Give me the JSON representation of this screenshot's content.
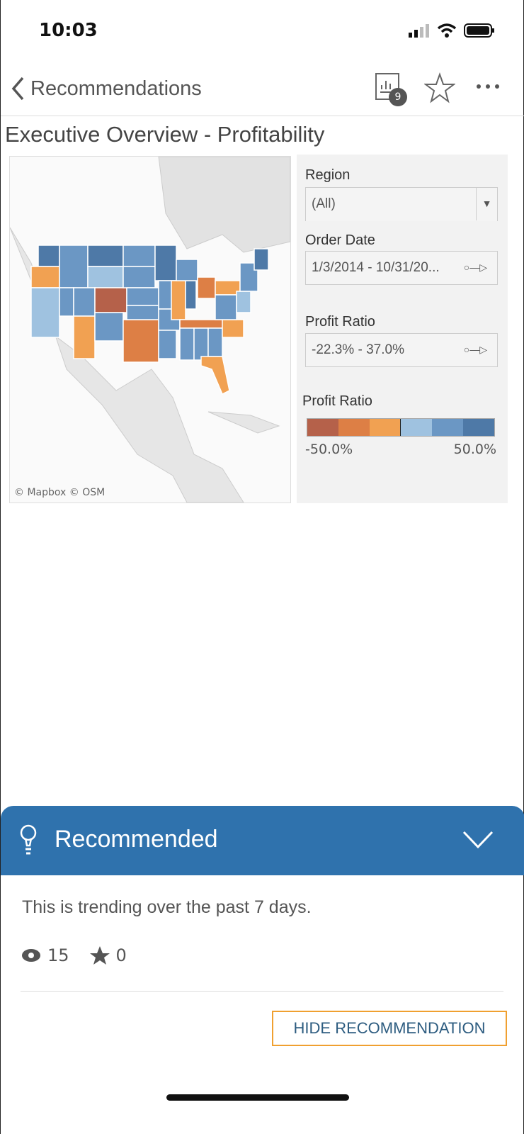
{
  "status_bar": {
    "time": "10:03"
  },
  "nav": {
    "back_label": "Recommendations",
    "badge_count": "9"
  },
  "page_title": "Executive Overview - Profitability",
  "map": {
    "attribution": "© Mapbox  © OSM"
  },
  "filters": {
    "region": {
      "label": "Region",
      "value": "(All)"
    },
    "order_date": {
      "label": "Order Date",
      "value": "1/3/2014 - 10/31/20..."
    },
    "profit_ratio": {
      "label": "Profit Ratio",
      "value": "-22.3% - 37.0%"
    }
  },
  "legend": {
    "title": "Profit Ratio",
    "min_label": "-50.0%",
    "max_label": "50.0%",
    "colors": [
      "#b5614a",
      "#dd7f45",
      "#f1a152",
      "#9fc2e0",
      "#6b97c4",
      "#4e79a7"
    ]
  },
  "recommendation": {
    "header": "Recommended",
    "text": "This is trending over the past 7 days.",
    "views": "15",
    "favorites": "0",
    "hide_label": "HIDE RECOMMENDATION",
    "color": "#2f72ad"
  }
}
